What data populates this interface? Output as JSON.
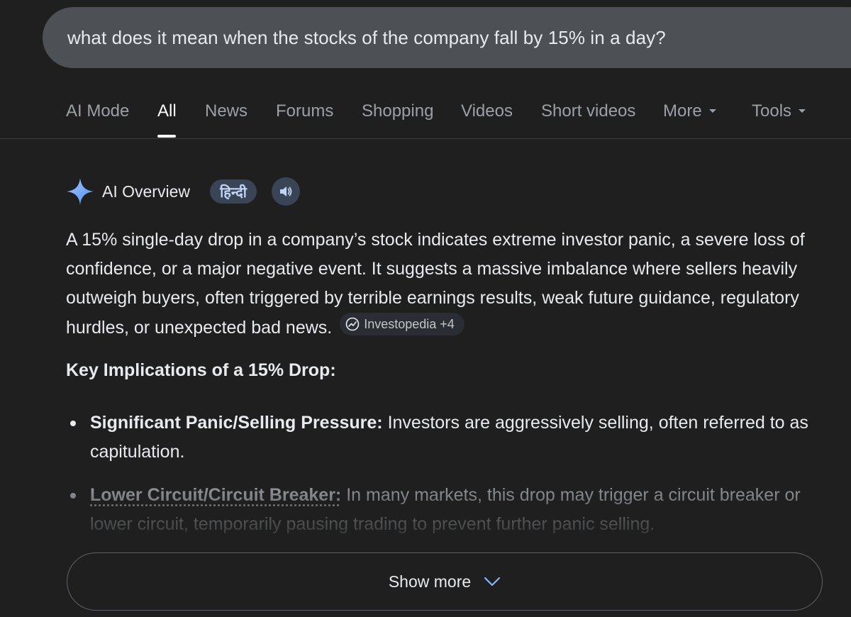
{
  "search": {
    "query": "what does it mean when the stocks of the company fall by 15% in a day?"
  },
  "tabs": [
    {
      "label": "AI Mode"
    },
    {
      "label": "All",
      "active": true
    },
    {
      "label": "News"
    },
    {
      "label": "Forums"
    },
    {
      "label": "Shopping"
    },
    {
      "label": "Videos"
    },
    {
      "label": "Short videos"
    },
    {
      "label": "More",
      "dropdown": true
    },
    {
      "label": "Tools",
      "dropdown": true
    }
  ],
  "ai_overview": {
    "title": "AI Overview",
    "language_chip": "हिन्दी",
    "speaker_icon": "speaker-icon",
    "summary": "A 15% single-day drop in a company’s stock indicates extreme investor panic, a severe loss of confidence, or a major negative event. It suggests a massive imbalance where sellers heavily outweigh buyers, often triggered by terrible earnings results, weak future guidance, regulatory hurdles, or unexpected bad news.",
    "source_chip": "Investopedia +4",
    "section_heading": "Key Implications of a 15% Drop:",
    "bullets": [
      {
        "term": "Significant Panic/Selling Pressure:",
        "text": " Investors are aggressively selling, often referred to as capitulation."
      },
      {
        "term": "Lower Circuit/Circuit Breaker:",
        "text": " In many markets, this drop may trigger a circuit breaker or lower circuit, temporarily pausing trading to prevent further panic selling."
      }
    ],
    "show_more_label": "Show more"
  },
  "colors": {
    "background": "#1f1f1f",
    "search_bar": "#4d5156",
    "chip_background": "#394457",
    "sparkle": "#8ab4f8"
  }
}
